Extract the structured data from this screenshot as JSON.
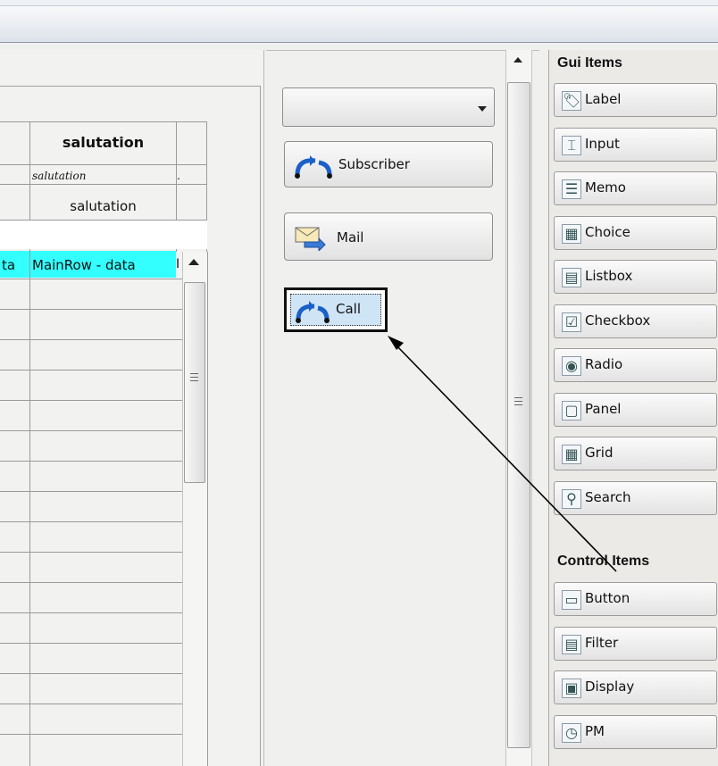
{
  "grid": {
    "column_header": "salutation",
    "field_label_italic": "salutation",
    "field_label": "salutation",
    "highlight_left_fragment": "ta",
    "highlight_cell": "MainRow - data",
    "highlight_cell_overflow": "I"
  },
  "middle": {
    "dropdown_value": "",
    "buttons": {
      "subscriber": "Subscriber",
      "mail": "Mail",
      "call": "Call"
    }
  },
  "palette": {
    "gui_header": "Gui Items",
    "gui_items": [
      {
        "label": "Label",
        "icon": "label-icon"
      },
      {
        "label": "Input",
        "icon": "input-icon"
      },
      {
        "label": "Memo",
        "icon": "memo-icon"
      },
      {
        "label": "Choice",
        "icon": "choice-icon"
      },
      {
        "label": "Listbox",
        "icon": "listbox-icon"
      },
      {
        "label": "Checkbox",
        "icon": "checkbox-icon"
      },
      {
        "label": "Radio",
        "icon": "radio-icon"
      },
      {
        "label": "Panel",
        "icon": "panel-icon"
      },
      {
        "label": "Grid",
        "icon": "grid-icon"
      },
      {
        "label": "Search",
        "icon": "search-icon"
      }
    ],
    "control_header": "Control Items",
    "control_items": [
      {
        "label": "Button",
        "icon": "button-icon"
      },
      {
        "label": "Filter",
        "icon": "filter-icon"
      },
      {
        "label": "Display",
        "icon": "display-icon"
      },
      {
        "label": "PM",
        "icon": "pm-icon"
      }
    ]
  },
  "colors": {
    "row_highlight": "#33ffff",
    "selection_fill": "#cfe4f5"
  }
}
